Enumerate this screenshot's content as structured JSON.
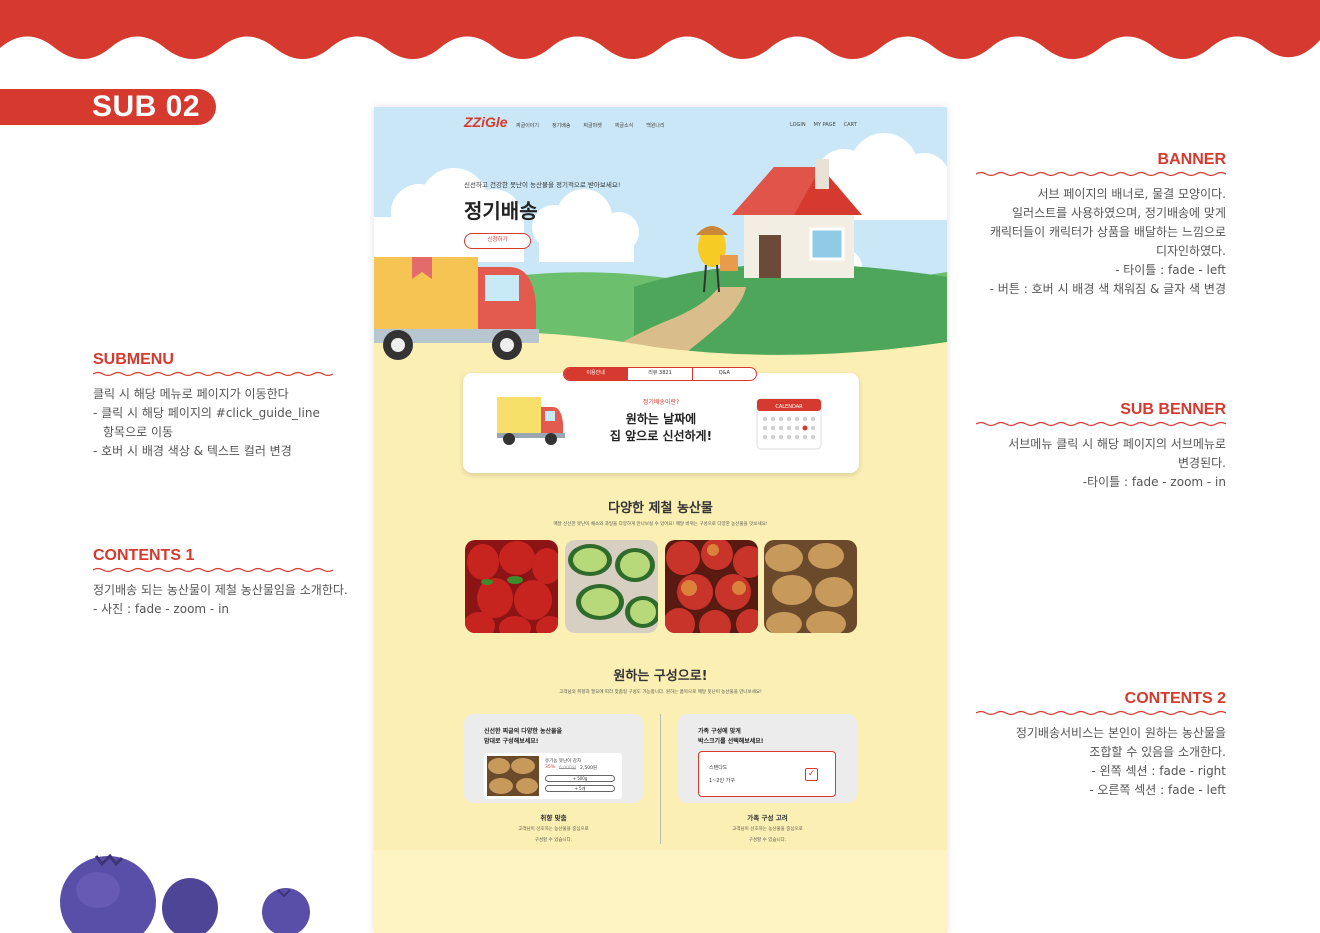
{
  "page": {
    "section_label": "SUB 02"
  },
  "colors": {
    "accent": "#d63a2f",
    "mock_bg": "#fcefb4",
    "sky": "#c8e6f5",
    "grass": "#6cbf6c"
  },
  "annotations": {
    "banner": {
      "title": "BANNER",
      "lines": [
        "서브 페이지의 배너로, 물결 모양이다.",
        "일러스트를 사용하였으며, 정기배송에 맞게",
        "캐릭터들이 캐릭터가 상품을 배달하는 느낌으로",
        "디자인하였다.",
        "- 타이틀 : fade - left",
        "- 버튼 : 호버 시 배경 색 채워짐 & 글자 색 변경"
      ]
    },
    "submenu": {
      "title": "SUBMENU",
      "lines": [
        "클릭 시 해당 메뉴로 페이지가 이동한다",
        "- 클릭 시 해당 페이지의 #click_guide_line",
        "  항목으로 이동",
        "- 호버 시 배경 색상 & 텍스트 컬러 변경"
      ]
    },
    "subbanner": {
      "title": "SUB BENNER",
      "lines": [
        "서브메뉴 클릭 시 해당 페이지의 서브메뉴로",
        "변경된다.",
        "-타이틀 :  fade - zoom - in"
      ]
    },
    "contents1": {
      "title": "CONTENTS 1",
      "lines": [
        "정기배송 되는 농산물이 제철 농산물임을 소개한다.",
        "- 사진 : fade - zoom - in"
      ]
    },
    "contents2": {
      "title": "CONTENTS 2",
      "lines": [
        "정기배송서비스는 본인이 원하는 농산물을",
        "조합할 수 있음을 소개한다.",
        "- 왼쪽 섹션 : fade - right",
        "- 오른쪽 섹션 :  fade - left"
      ]
    }
  },
  "mockup": {
    "logo": "ZZiGle",
    "nav": [
      "찌글이야기",
      "정기배송",
      "찌글마켓",
      "찌글소식",
      "백원나리"
    ],
    "util": [
      "LOGIN",
      "MY PAGE",
      "CART"
    ],
    "hero": {
      "subtitle": "신선하고 건강한 못난이 농산물을 정기적으로 받아보세요!",
      "title": "정기배송",
      "button": "신청하기"
    },
    "tabs": [
      {
        "label": "이용안내",
        "active": true
      },
      {
        "label": "리뷰 3821",
        "active": false
      },
      {
        "label": "Q&A",
        "active": false
      }
    ],
    "card": {
      "kicker": "정기배송이란?",
      "title_line1": "원하는 날짜에",
      "title_line2": "집 앞으로 신선하게!",
      "calendar_label": "CALENDAR"
    },
    "section1": {
      "title": "다양한 제철 농산물",
      "desc": "매달 신선한 못난이 채소와 과일을 다양하게 만나보실 수 있어요! 매달 바뀌는 구성으로 다양한 농산물을 맛보세요!",
      "photos": [
        "strawberry",
        "cucumber",
        "apple",
        "potato"
      ]
    },
    "section2": {
      "title": "원하는 구성으로!",
      "desc": "고객님의 취향과 필요에 따라 맞춤형 구성도 가능합니다. 원하는 품목으로 매달 못난이 농산물을 만나보세요!",
      "left": {
        "panel_line1": "신선한 찌글의 다양한 농산물을",
        "panel_line2": "맘대로 구성해보세요!",
        "product_name": "유기농 못난이 감자",
        "discount": "35%",
        "old_price": "6,000원",
        "price": "2,500원",
        "opt1": "+ 500g",
        "opt2": "+ 5개",
        "caption_title": "취향 맞춤",
        "caption_line1": "고객님이 선호하는 농산물을 중심으로",
        "caption_line2": "구성할 수 있습니다."
      },
      "right": {
        "panel_line1": "가족 구성에 맞게",
        "panel_line2": "박스크기를 선택해보세요!",
        "option_name": "스탠다드",
        "option_desc": "1~2인 가구",
        "caption_title": "가족 구성 고려",
        "caption_line1": "고객님이 선호하는 농산물을 중심으로",
        "caption_line2": "구성할 수 있습니다."
      }
    }
  }
}
